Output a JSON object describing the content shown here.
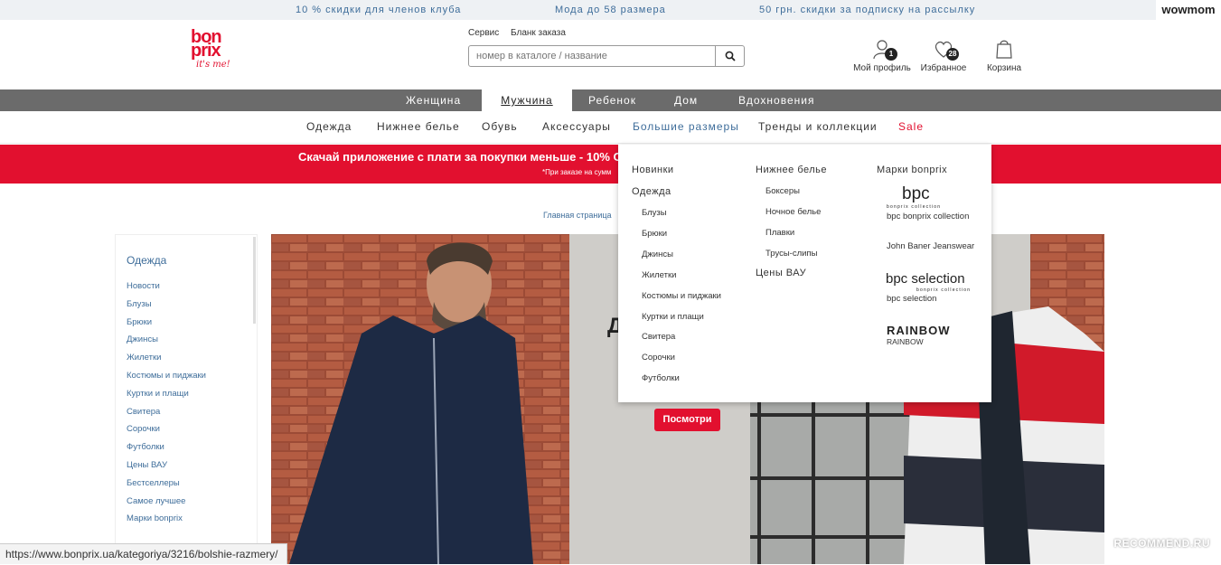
{
  "promo": {
    "items": [
      "10 % скидки для членов клуба",
      "Мода до 58 размера",
      "50 грн. скидки за подписку на рассылку"
    ],
    "corner_tag": "wowmom"
  },
  "header": {
    "logo": {
      "line1": "bon",
      "line2": "prix",
      "tagline": "it's me!"
    },
    "service_links": [
      "Сервис",
      "Бланк заказа"
    ],
    "search": {
      "placeholder": "номер в каталоге / название"
    },
    "profile": {
      "label": "Мой профиль",
      "badge": "1"
    },
    "favorites": {
      "label": "Избранное",
      "badge": "28"
    },
    "cart": {
      "label": "Корзина"
    }
  },
  "gender_nav": [
    "Женщина",
    "Мужчина",
    "Ребенок",
    "Дом",
    "Вдохновения"
  ],
  "category_nav": [
    "Одежда",
    "Нижнее белье",
    "Обувь",
    "Аксессуары",
    "Большие размеры",
    "Тренды и коллекции",
    "Sale"
  ],
  "banner": {
    "text": "Скачай  приложение с плати за покупки меньше - ",
    "highlight": "10% О",
    "note": "*При заказе на сумм"
  },
  "breadcrumb": "Главная страница",
  "sidebar": {
    "title": "Одежда",
    "items": [
      "Новости",
      "Блузы",
      "Брюки",
      "Джинсы",
      "Жилетки",
      "Костюмы и пиджаки",
      "Куртки и плащи",
      "Свитера",
      "Сорочки",
      "Футболки",
      "Цены ВАУ",
      "Бестселлеры",
      "Самое лучшее",
      "Марки bonprix"
    ]
  },
  "hero": {
    "headline": "Д",
    "button": "Посмотри"
  },
  "dropdown": {
    "col1": {
      "new": "Новинки",
      "clothing": "Одежда",
      "items": [
        "Блузы",
        "Брюки",
        "Джинсы",
        "Жилетки",
        "Костюмы и пиджаки",
        "Куртки и плащи",
        "Свитера",
        "Сорочки",
        "Футболки"
      ]
    },
    "col2": {
      "title": "Нижнее белье",
      "items": [
        "Боксеры",
        "Ночное белье",
        "Плавки",
        "Трусы-слипы"
      ],
      "wow": "Цены ВАУ"
    },
    "col3": {
      "title": "Марки bonprix",
      "bpc_logo": "bpc",
      "bpc_sub": "bonprix collection",
      "bpc_label": "bpc bonprix collection",
      "john": "John Baner Jeanswear",
      "sel_logo": "bpc selection",
      "sel_sub": "bonprix collection",
      "sel_label": "bpc selection",
      "rainbow_logo": "RAINBOW",
      "rainbow_label": "RAINBOW"
    }
  },
  "status_url": "https://www.bonprix.ua/kategoriya/3216/bolshie-razmery/",
  "watermark": "RECOMMEND.RU",
  "colors": {
    "brand_red": "#e2102f",
    "link_blue": "#3e6d9a",
    "nav_gray": "#6b6b6b"
  }
}
